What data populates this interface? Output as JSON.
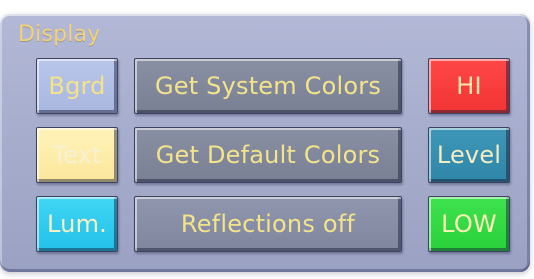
{
  "panel": {
    "title": "Display"
  },
  "buttons": {
    "bgrd": "Bgrd",
    "text": "Text",
    "lum": "Lum.",
    "get_system_colors": "Get System Colors",
    "get_default_colors": "Get Default Colors",
    "reflections_off": "Reflections off",
    "hi": "HI",
    "level": "Level",
    "low": "LOW"
  },
  "colors": {
    "panel_background": "#a9b0cf",
    "title_text": "#f2d27a",
    "button_text": "#f3e38a",
    "bgrd_swatch": "#b2bfe6",
    "text_swatch": "#fdeda9",
    "lum_swatch": "#2cc8ee",
    "command_button": "#8088a0",
    "hi_swatch": "#f53b3b",
    "level_swatch": "#3790b1",
    "low_swatch": "#33d942"
  }
}
